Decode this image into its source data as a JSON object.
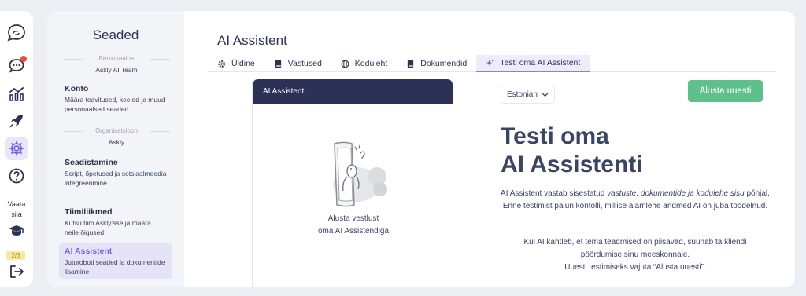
{
  "rail": {
    "vaata_line1": "Vaata",
    "vaata_line2": "siia",
    "progress": "2/3",
    "icons": [
      "logo-icon",
      "chat-icon",
      "stats-icon",
      "rocket-icon",
      "gear-icon",
      "help-icon",
      "graduation-cap-icon",
      "logout-icon"
    ]
  },
  "settings": {
    "title": "Seaded",
    "personal": {
      "heading": "Personaalne",
      "name": "Askly AI Team"
    },
    "konto": {
      "title": "Konto",
      "desc": "Määra teavitused, keeled ja muud personaalsed seaded"
    },
    "org": {
      "heading": "Organisatsioon",
      "name": "Askly"
    },
    "seadistamine": {
      "title": "Seadistamine",
      "desc": "Script, õpetused ja sotsiaalmeedia integreerimine"
    },
    "tiimiliikmed": {
      "title": "Tiimiliikmed",
      "desc": "Kutsu tiim Askly'sse ja määra neile õigused"
    },
    "ai": {
      "title": "AI Assistent",
      "desc": "Juturoboti seaded ja dokumentide lisamine"
    }
  },
  "main": {
    "title": "AI Assistent",
    "tabs": [
      {
        "label": "Üldine",
        "icon": "gear-icon"
      },
      {
        "label": "Vastused",
        "icon": "book-icon"
      },
      {
        "label": "Koduleht",
        "icon": "globe-icon"
      },
      {
        "label": "Dokumendid",
        "icon": "book-icon"
      },
      {
        "label": "Testi oma AI Assistent",
        "icon": "sparkle-icon"
      }
    ],
    "active_tab": 4
  },
  "chat": {
    "header": "AI Assistent",
    "empty_line1": "Alusta vestlust",
    "empty_line2": "oma AI Assistendiga"
  },
  "test": {
    "language": "Estonian",
    "reset_button": "Alusta uuesti",
    "hero_line1": "Testi oma",
    "hero_line2": "AI Assistenti",
    "p1_before": "AI Assistent vastab sisestatud ",
    "p1_em": "vastuste, dokumentide ja kodulehe sisu",
    "p1_after": " põhjal. Enne testimist palun kontolli, millise alamlehe andmed AI on juba töödelnud.",
    "p2_line1": "Kui AI kahtleb, et tema teadmised on piisavad, suunab ta kliendi",
    "p2_line2": "pöördumise sinu meeskonnale.",
    "p2_line3": "Uuesti testimiseks vajuta “Alusta uuesti”."
  },
  "colors": {
    "accent": "#7366e0",
    "button_green": "#5fc08b",
    "chat_header": "#2c3157",
    "notification": "#ef4a42"
  }
}
